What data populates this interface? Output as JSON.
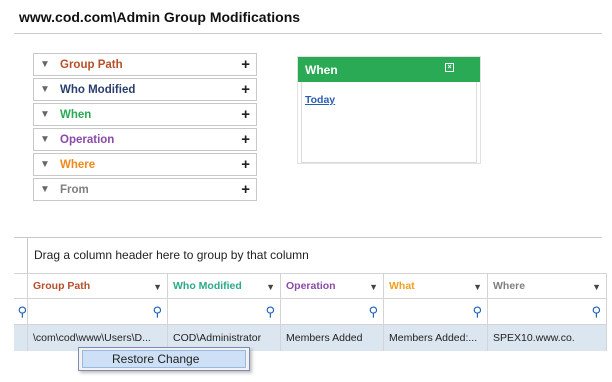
{
  "title": "www.cod.com\\Admin Group Modifications",
  "filters": [
    {
      "label": "Group Path",
      "color": "#b5502a"
    },
    {
      "label": "Who Modified",
      "color": "#2a3f6b"
    },
    {
      "label": "When",
      "color": "#2aaa55"
    },
    {
      "label": "Operation",
      "color": "#8a4aa8"
    },
    {
      "label": "Where",
      "color": "#f08a1c"
    },
    {
      "label": "From",
      "color": "#7f7f7f"
    }
  ],
  "filter_add_symbol": "+",
  "when_panel": {
    "title": "When",
    "link": "Today",
    "header_color": "#2aaa55"
  },
  "grid": {
    "group_hint": "Drag a column header here to group by that column",
    "columns": [
      {
        "label": "Group Path",
        "color": "#b5502a"
      },
      {
        "label": "Who Modified",
        "color": "#2aaa88"
      },
      {
        "label": "Operation",
        "color": "#8a4aa8"
      },
      {
        "label": "What",
        "color": "#f0a020"
      },
      {
        "label": "Where",
        "color": "#7f7f7f"
      }
    ],
    "row": [
      "\\com\\cod\\www\\Users\\D...",
      "COD\\Administrator",
      "Members Added",
      "Members Added:...",
      "SPEX10.www.co."
    ]
  },
  "context_menu": {
    "item": "Restore Change"
  }
}
